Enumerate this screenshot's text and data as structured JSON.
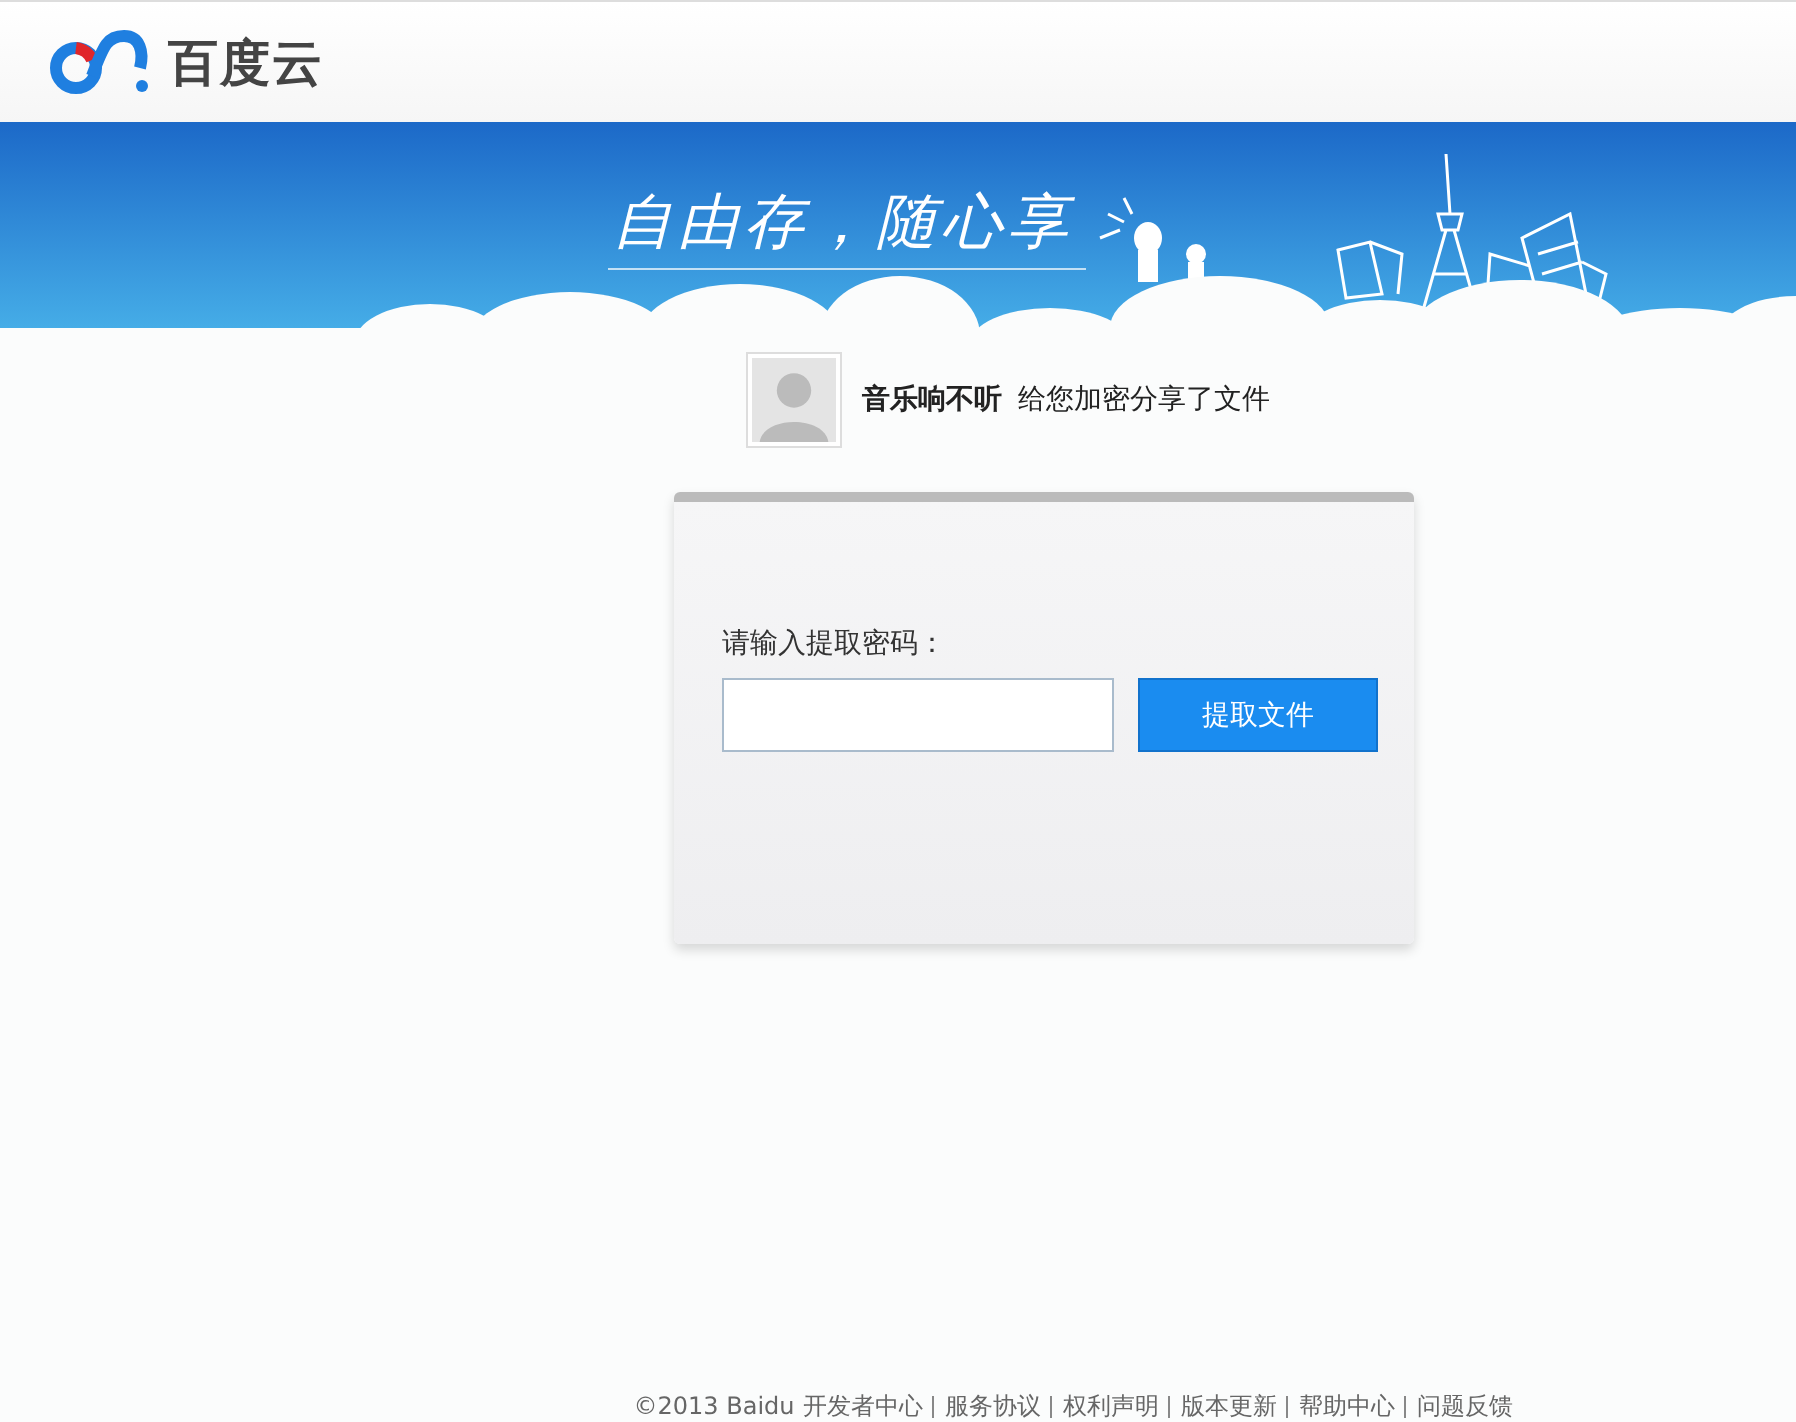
{
  "header": {
    "logo_text": "百度云"
  },
  "banner": {
    "slogan": "自由存，随心享"
  },
  "share": {
    "user_name": "音乐响不听",
    "message": "给您加密分享了文件"
  },
  "password_card": {
    "label": "请输入提取密码：",
    "button": "提取文件"
  },
  "footer": {
    "copyright": "©2013 Baidu",
    "links": [
      "开发者中心",
      "服务协议",
      "权利声明",
      "版本更新",
      "帮助中心",
      "问题反馈"
    ]
  }
}
